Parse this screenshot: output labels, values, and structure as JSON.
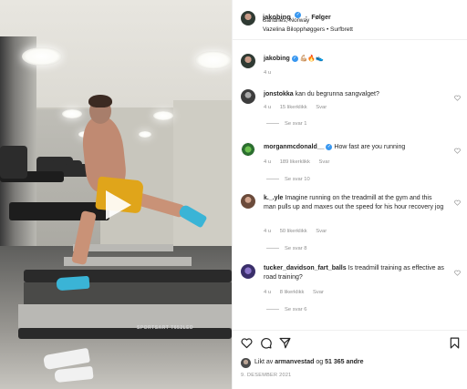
{
  "header": {
    "username": "jakobing",
    "separator": "•",
    "follow_label": "Følger",
    "location": "Sandnes, Norway",
    "audio": "Vazelina Bilopphøggers • Surfbrett"
  },
  "caption": {
    "username": "jakobing",
    "emoji": "💪🏼🔥👟",
    "time": "4 u"
  },
  "comments": [
    {
      "username": "jonstokka",
      "text": "kan du begrunna sangvalget?",
      "time": "4 u",
      "likes": "15 likerklikk",
      "reply_label": "Svar",
      "view_replies": "Se svar 1",
      "verified": false
    },
    {
      "username": "morganmcdonald__",
      "text": "How fast are you running",
      "time": "4 u",
      "likes": "189 likerklikk",
      "reply_label": "Svar",
      "view_replies": "Se svar 10",
      "verified": true
    },
    {
      "username": "k._.yle",
      "text": "Imagine running on the treadmill at the gym and this man pulls up and maxes out the speed for his hour recovery jog",
      "time": "4 u",
      "likes": "50 likerklikk",
      "reply_label": "Svar",
      "view_replies": "Se svar 8",
      "verified": false
    },
    {
      "username": "tucker_davidson_fart_balls",
      "text": "Is treadmill training as effective as road training?",
      "time": "4 u",
      "likes": "8 likerklikk",
      "reply_label": "Svar",
      "view_replies": "Se svar 6",
      "verified": false
    }
  ],
  "likes": {
    "prefix": "Likt av",
    "user": "armanvestad",
    "conjunction": "og",
    "count": "51 365 andre"
  },
  "date": "9. DESEMBER 2021",
  "video": {
    "treadmill_brand": "SPORTSART T652LED"
  },
  "icons": [
    "heart-icon",
    "comment-icon",
    "share-icon",
    "bookmark-icon",
    "play-icon",
    "verified-icon"
  ]
}
